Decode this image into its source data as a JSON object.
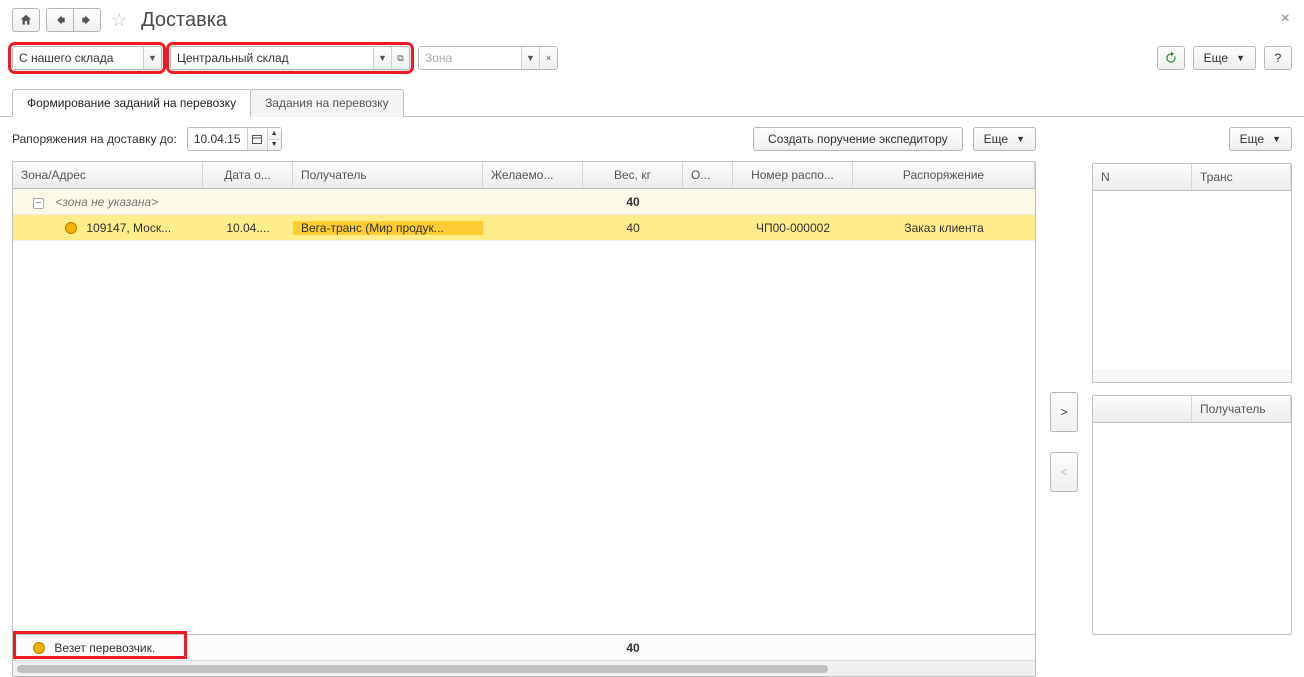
{
  "header": {
    "title": "Доставка"
  },
  "filters": {
    "warehouse_mode": "С нашего склада",
    "warehouse": "Центральный склад",
    "zone_placeholder": "Зона"
  },
  "topbuttons": {
    "more": "Еще",
    "help": "?"
  },
  "tabs": {
    "form": "Формирование заданий на перевозку",
    "tasks": "Задания на перевозку"
  },
  "action": {
    "label": "Рапоряжения на доставку до:",
    "date": "10.04.15",
    "create": "Создать поручение экспедитору",
    "more": "Еще"
  },
  "table": {
    "headers": {
      "zone": "Зона/Адрес",
      "date": "Дата о...",
      "recv": "Получатель",
      "wish": "Желаемо...",
      "weight": "Вес, кг",
      "ship": "О...",
      "num": "Номер распо...",
      "order": "Распоряжение"
    },
    "group": {
      "label": "<зона не указана>",
      "weight": "40"
    },
    "row": {
      "zone": "109147, Моск...",
      "date": "10.04....",
      "recv": "Вега-транс (Мир продук...",
      "weight": "40",
      "num": "ЧП00-000002",
      "order": "Заказ клиента"
    },
    "footer": {
      "legend": "Везет перевозчик.",
      "weight": "40"
    }
  },
  "transfer": {
    "right": ">",
    "left": "<"
  },
  "right": {
    "more": "Еще",
    "headers": {
      "n": "N",
      "trans": "Транс"
    },
    "lower_headers": {
      "blank": "",
      "recv": "Получатель"
    }
  }
}
